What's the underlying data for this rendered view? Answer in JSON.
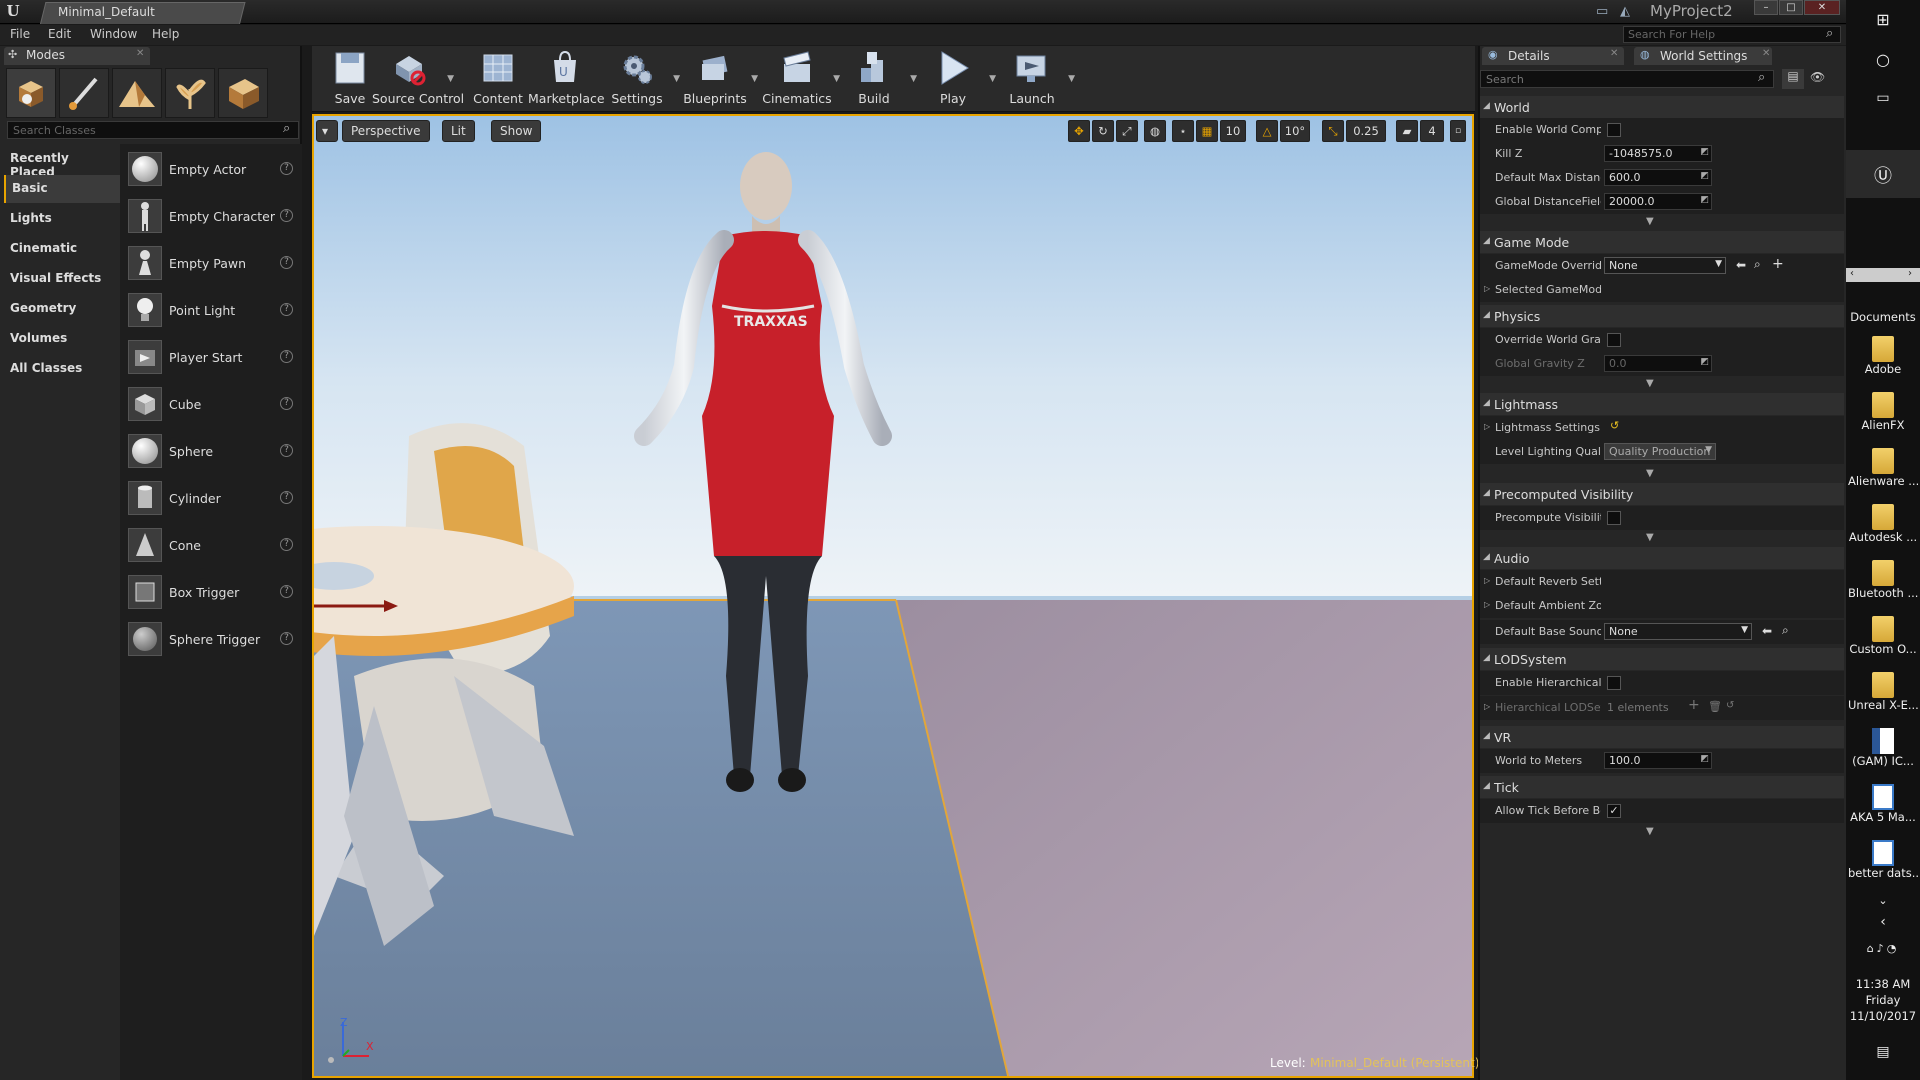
{
  "titlebar": {
    "doc_tab": "Minimal_Default",
    "project": "MyProject2"
  },
  "menu": [
    "File",
    "Edit",
    "Window",
    "Help"
  ],
  "help_search": {
    "placeholder": "Search For Help"
  },
  "modes": {
    "tab_label": "Modes",
    "search_placeholder": "Search Classes",
    "categories": [
      "Recently Placed",
      "Basic",
      "Lights",
      "Cinematic",
      "Visual Effects",
      "Geometry",
      "Volumes",
      "All Classes"
    ],
    "selected_category": "Basic",
    "items": [
      "Empty Actor",
      "Empty Character",
      "Empty Pawn",
      "Point Light",
      "Player Start",
      "Cube",
      "Sphere",
      "Cylinder",
      "Cone",
      "Box Trigger",
      "Sphere Trigger"
    ],
    "help_glyph": "?"
  },
  "toolbar": [
    "Save",
    "Source Control",
    "Content",
    "Marketplace",
    "Settings",
    "Blueprints",
    "Cinematics",
    "Build",
    "Play",
    "Launch"
  ],
  "viewport": {
    "perspective": "Perspective",
    "lit": "Lit",
    "show": "Show",
    "grid_snap": "10",
    "rot_snap": "10°",
    "scale_snap": "0.25",
    "cam_speed": "4",
    "level_label": "Level:",
    "level_name": "Minimal_Default (Persistent)",
    "axis_z": "Z",
    "axis_x": "X"
  },
  "details": {
    "tab_details": "Details",
    "tab_world_settings": "World Settings",
    "search_placeholder": "Search",
    "world": {
      "title": "World",
      "enable_world_compo": "Enable World Compo",
      "kill_z_label": "Kill Z",
      "kill_z": "-1048575.0",
      "max_dist_label": "Default Max Distanc",
      "max_dist": "600.0",
      "gdf_label": "Global DistanceField",
      "gdf": "20000.0"
    },
    "game_mode": {
      "title": "Game Mode",
      "override_label": "GameMode Override",
      "override_value": "None",
      "selected_label": "Selected GameMod"
    },
    "physics": {
      "title": "Physics",
      "override_gravity": "Override World Gravi",
      "gravity_label": "Global Gravity Z",
      "gravity": "0.0"
    },
    "lightmass": {
      "title": "Lightmass",
      "settings_label": "Lightmass Settings",
      "quality_label": "Level Lighting Qualit",
      "quality_value": "Quality Production"
    },
    "precomputed": {
      "title": "Precomputed Visibility",
      "label": "Precompute Visibilit"
    },
    "audio": {
      "title": "Audio",
      "reverb": "Default Reverb Setti",
      "ambient": "Default Ambient Zon",
      "base_sound": "Default Base Sound I",
      "base_sound_value": "None"
    },
    "lod": {
      "title": "LODSystem",
      "enable": "Enable Hierarchical L",
      "setup": "Hierarchical LODSet",
      "setup_value": "1 elements"
    },
    "vr": {
      "title": "VR",
      "world_to_meters": "World to Meters",
      "world_to_meters_value": "100.0"
    },
    "tick": {
      "title": "Tick",
      "allow": "Allow Tick Before Be"
    }
  },
  "taskbar": {
    "documents": "Documents",
    "desktop_items": [
      "Adobe",
      "AlienFX",
      "Alienware ...",
      "Autodesk ...",
      "Bluetooth ...",
      "Custom O...",
      "Unreal X-E...",
      "(GAM) IC...",
      "AKA 5 Ma...",
      "better dats..."
    ],
    "time": "11:38 AM",
    "day": "Friday",
    "date": "11/10/2017"
  }
}
